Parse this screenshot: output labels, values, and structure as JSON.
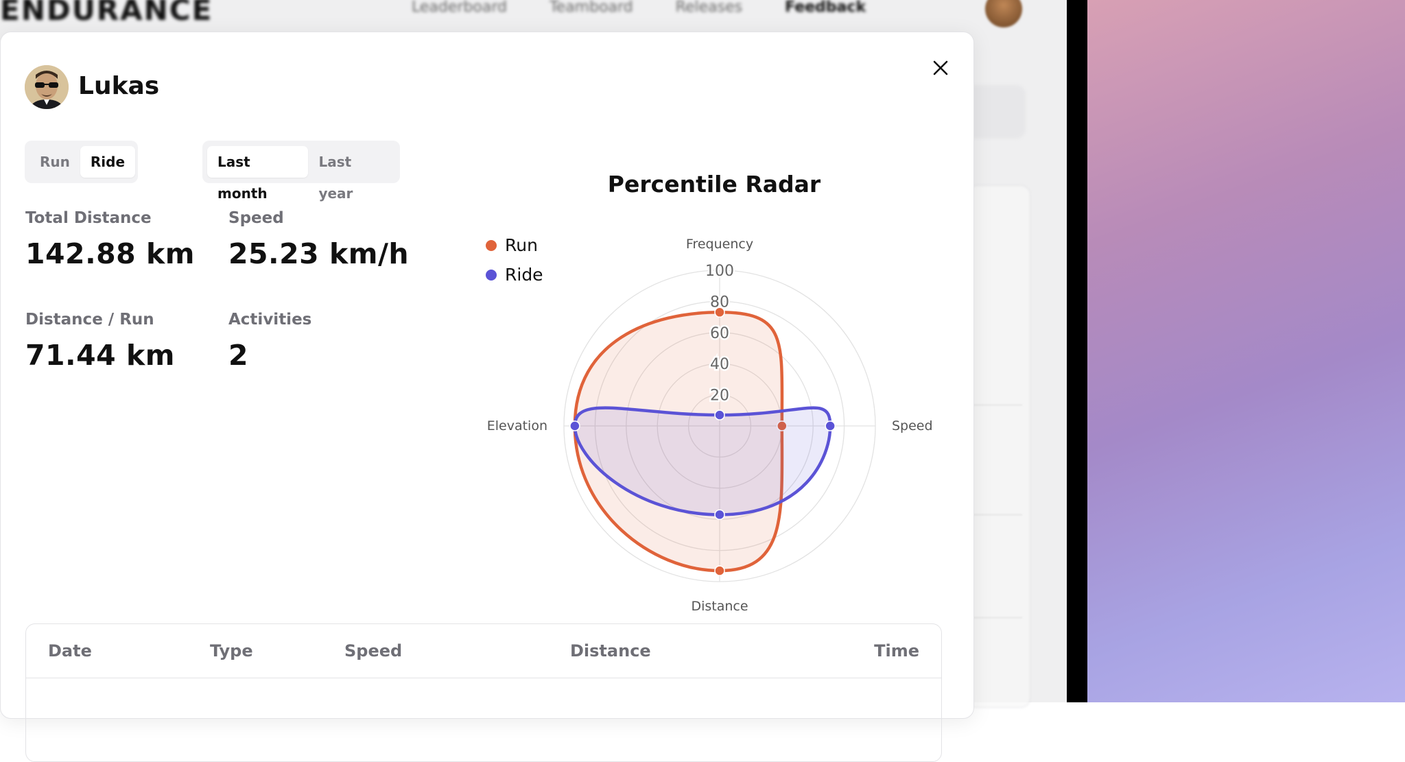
{
  "background": {
    "logo": "ENDURANCE",
    "nav": [
      "Leaderboard",
      "Teamboard",
      "Releases",
      "Feedback"
    ]
  },
  "modal": {
    "user_name": "Lukas",
    "close_icon": "close-icon",
    "type_toggle": [
      {
        "label": "Run",
        "active": false
      },
      {
        "label": "Ride",
        "active": true
      }
    ],
    "period_toggle": [
      {
        "label": "Last month",
        "active": true
      },
      {
        "label": "Last year",
        "active": false
      }
    ],
    "stats": {
      "total_distance": {
        "label": "Total Distance",
        "value": "142.88 km"
      },
      "speed": {
        "label": "Speed",
        "value": "25.23 km/h"
      },
      "distance_per_run": {
        "label": "Distance / Run",
        "value": "71.44 km"
      },
      "activities": {
        "label": "Activities",
        "value": "2"
      }
    },
    "table": {
      "columns": [
        "Date",
        "Type",
        "Speed",
        "Distance",
        "Time"
      ]
    }
  },
  "chart_data": {
    "type": "radar",
    "title": "Percentile Radar",
    "axes": [
      "Frequency",
      "Speed",
      "Distance",
      "Elevation"
    ],
    "r_ticks": [
      20,
      40,
      60,
      80,
      100
    ],
    "r_range": [
      0,
      100
    ],
    "legend_position": "top-left",
    "series": [
      {
        "name": "Run",
        "color": "#e0633a",
        "fill": "rgba(224,99,58,0.12)",
        "values": [
          73,
          40,
          93,
          93
        ]
      },
      {
        "name": "Ride",
        "color": "#5b53d6",
        "fill": "rgba(91,83,214,0.12)",
        "values": [
          7,
          71,
          57,
          93
        ]
      }
    ]
  }
}
